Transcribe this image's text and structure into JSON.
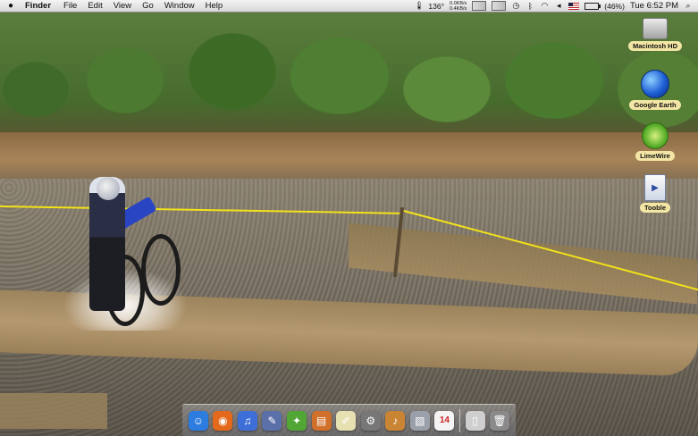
{
  "menubar": {
    "app_name": "Finder",
    "menus": [
      "File",
      "Edit",
      "View",
      "Go",
      "Window",
      "Help"
    ],
    "status": {
      "temperature": "136°",
      "net_down": "0.0KB/s",
      "net_up": "0.4KB/s",
      "battery_percent": "(46%)",
      "battery_level": 0.46,
      "clock": "Tue 6:52 PM"
    }
  },
  "desktop_icons": [
    {
      "label": "Macintosh HD",
      "icon": "hard-drive-icon"
    },
    {
      "label": "Google Earth",
      "icon": "google-earth-icon"
    },
    {
      "label": "LimeWire",
      "icon": "limewire-icon"
    },
    {
      "label": "Tooble",
      "icon": "tooble-icon"
    }
  ],
  "dock": {
    "items": [
      {
        "name": "finder",
        "glyph": "☺",
        "color": "#2d7de0"
      },
      {
        "name": "firefox",
        "glyph": "◉",
        "color": "#e4691c"
      },
      {
        "name": "itunes",
        "glyph": "♫",
        "color": "#3e6fd8"
      },
      {
        "name": "xcode",
        "glyph": "✎",
        "color": "#5b6fa8"
      },
      {
        "name": "limewire",
        "glyph": "✦",
        "color": "#52a635"
      },
      {
        "name": "presentation",
        "glyph": "▤",
        "color": "#d0702a"
      },
      {
        "name": "text-editor",
        "glyph": "✐",
        "color": "#e7e0b0"
      },
      {
        "name": "system-preferences",
        "glyph": "⚙",
        "color": "#777777"
      },
      {
        "name": "garageband",
        "glyph": "♪",
        "color": "#c98534"
      },
      {
        "name": "preview",
        "glyph": "▧",
        "color": "#9aa0aa"
      },
      {
        "name": "ical",
        "glyph": "14",
        "color": "#f4f4f4"
      },
      {
        "name": "documents",
        "glyph": "▯",
        "color": "#cfcfcf"
      },
      {
        "name": "trash",
        "glyph": "🗑",
        "color": "#8a8a8a"
      }
    ]
  }
}
